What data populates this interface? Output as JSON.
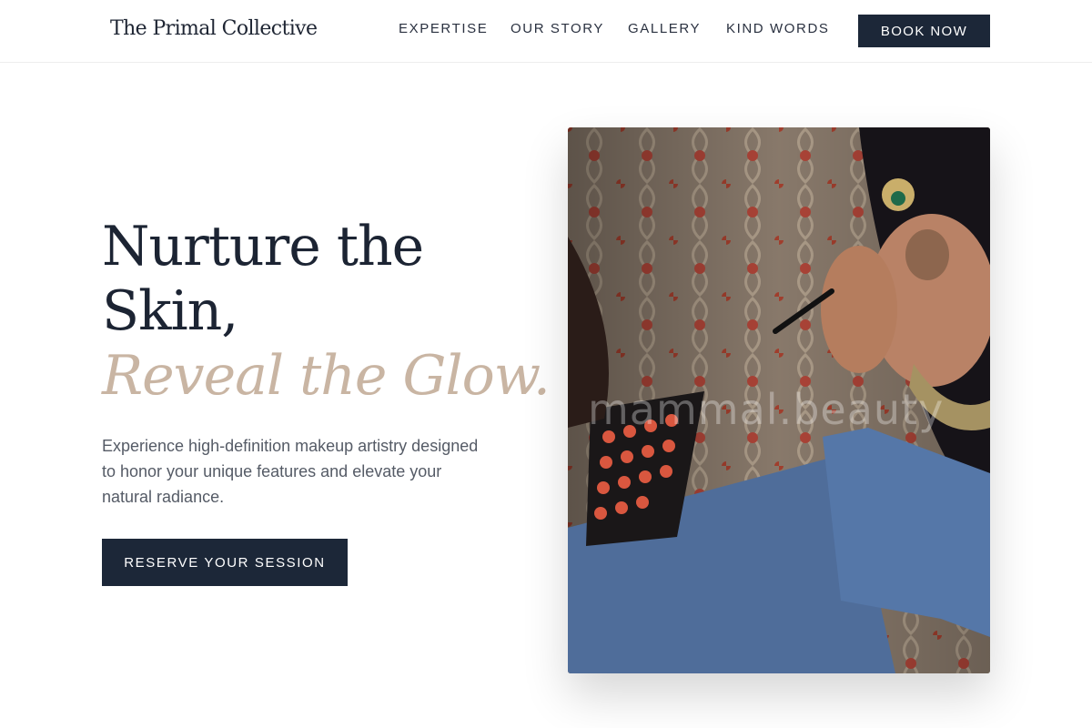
{
  "header": {
    "logo": "The Primal Collective",
    "nav": [
      {
        "label": "EXPERTISE"
      },
      {
        "label": "OUR STORY"
      },
      {
        "label": "GALLERY"
      },
      {
        "label": "KIND WORDS"
      }
    ],
    "book_label": "BOOK NOW"
  },
  "hero": {
    "headline_line1": "Nurture the",
    "headline_line2": "Skin,",
    "headline_accent": "Reveal the Glow.",
    "subtext": "Experience high-definition makeup artistry designed to honor your unique features and elevate your natural radiance.",
    "cta_label": "RESERVE YOUR SESSION",
    "image": {
      "description_icon": "makeup-artist-photo",
      "watermark": "mammal.beauty"
    }
  },
  "colors": {
    "navy": "#1c2738",
    "accent": "#c9b5a3",
    "text_muted": "#555b66"
  }
}
